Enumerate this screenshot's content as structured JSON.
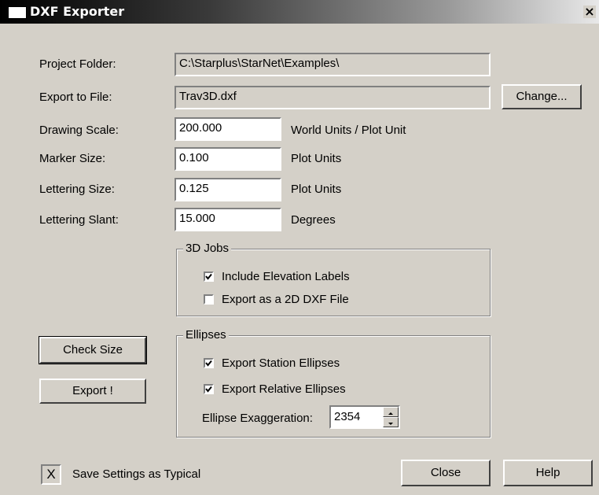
{
  "window": {
    "title": "DXF Exporter",
    "close_glyph": "×"
  },
  "fields": {
    "project_folder": {
      "label": "Project Folder:",
      "value": "C:\\Starplus\\StarNet\\Examples\\"
    },
    "export_to_file": {
      "label": "Export to File:",
      "value": "Trav3D.dxf",
      "change_label": "Change..."
    },
    "drawing_scale": {
      "label": "Drawing Scale:",
      "value": "200.000",
      "unit": "World Units / Plot Unit"
    },
    "marker_size": {
      "label": "Marker Size:",
      "value": "0.100",
      "unit": "Plot Units"
    },
    "lettering_size": {
      "label": "Lettering Size:",
      "value": "0.125",
      "unit": "Plot Units"
    },
    "lettering_slant": {
      "label": "Lettering Slant:",
      "value": "15.000",
      "unit": "Degrees"
    }
  },
  "jobs3d": {
    "title": "3D Jobs",
    "include_elevation_labels": {
      "label": "Include Elevation Labels",
      "checked": true
    },
    "export_as_2d": {
      "label": "Export as a 2D DXF File",
      "checked": false
    }
  },
  "ellipses": {
    "title": "Ellipses",
    "export_station": {
      "label": "Export Station Ellipses",
      "checked": true
    },
    "export_relative": {
      "label": "Export Relative Ellipses",
      "checked": true
    },
    "exaggeration": {
      "label": "Ellipse Exaggeration:",
      "value": "2354"
    }
  },
  "buttons": {
    "check_size": "Check Size",
    "export": "Export !",
    "close": "Close",
    "help": "Help"
  },
  "save_typical": {
    "label": "Save Settings as Typical",
    "mark": "X"
  },
  "icons": {
    "check": "checkmark-icon",
    "spin_up": "spin-up-arrow-icon",
    "spin_down": "spin-down-arrow-icon"
  }
}
